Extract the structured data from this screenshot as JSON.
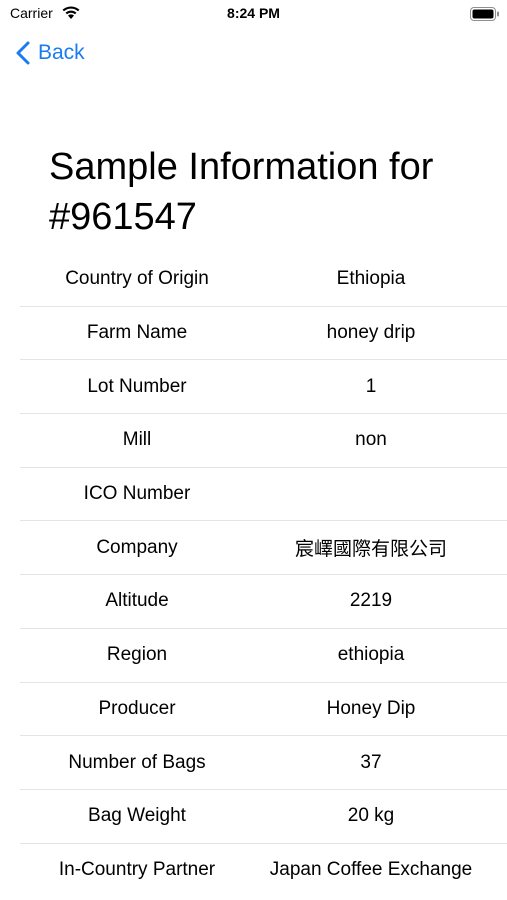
{
  "status_bar": {
    "carrier": "Carrier",
    "time": "8:24 PM"
  },
  "nav": {
    "back_label": "Back"
  },
  "title": "Sample Information for #961547",
  "accent_color": "#1a7cf0",
  "rows": [
    {
      "label": "Country of Origin",
      "value": "Ethiopia"
    },
    {
      "label": "Farm Name",
      "value": "honey drip"
    },
    {
      "label": "Lot Number",
      "value": "1"
    },
    {
      "label": "Mill",
      "value": "non"
    },
    {
      "label": "ICO Number",
      "value": ""
    },
    {
      "label": "Company",
      "value": "宸嶧國際有限公司"
    },
    {
      "label": "Altitude",
      "value": "2219"
    },
    {
      "label": "Region",
      "value": "ethiopia"
    },
    {
      "label": "Producer",
      "value": "Honey Dip"
    },
    {
      "label": "Number of Bags",
      "value": "37"
    },
    {
      "label": "Bag Weight",
      "value": "20 kg"
    },
    {
      "label": "In-Country Partner",
      "value": "Japan Coffee Exchange"
    }
  ]
}
